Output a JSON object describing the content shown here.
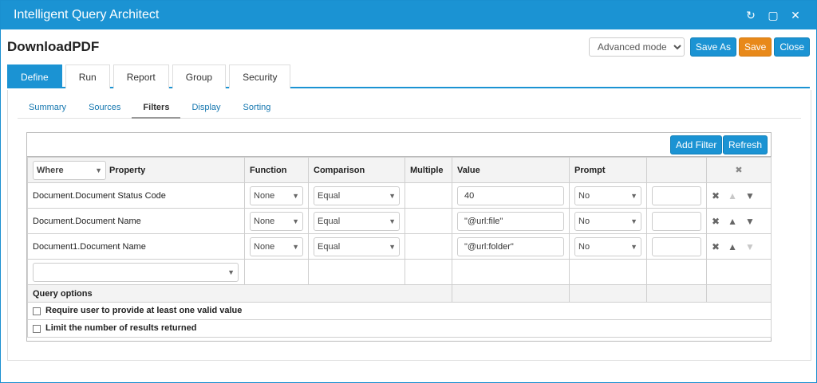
{
  "window": {
    "title": "Intelligent Query Architect",
    "icons": [
      "refresh-icon",
      "maximize-icon",
      "close-icon"
    ]
  },
  "header": {
    "doc_title": "DownloadPDF",
    "mode": "Advanced mode",
    "save_as": "Save As",
    "save": "Save",
    "close": "Close"
  },
  "tabs": [
    {
      "label": "Define",
      "active": true
    },
    {
      "label": "Run"
    },
    {
      "label": "Report"
    },
    {
      "label": "Group"
    },
    {
      "label": "Security"
    }
  ],
  "subtabs": [
    {
      "label": "Summary"
    },
    {
      "label": "Sources"
    },
    {
      "label": "Filters",
      "active": true
    },
    {
      "label": "Display"
    },
    {
      "label": "Sorting"
    }
  ],
  "toolbar": {
    "add_filter": "Add Filter",
    "refresh": "Refresh"
  },
  "columns": {
    "where": "Where",
    "property": "Property",
    "function": "Function",
    "comparison": "Comparison",
    "multiple": "Multiple",
    "value": "Value",
    "prompt": "Prompt"
  },
  "rows": [
    {
      "property": "Document.Document Status Code",
      "function": "None",
      "comparison": "Equal",
      "value": "40",
      "prompt": "No"
    },
    {
      "property": "Document.Document Name",
      "function": "None",
      "comparison": "Equal",
      "value": "\"@url:file\"",
      "prompt": "No"
    },
    {
      "property": "Document1.Document Name",
      "function": "None",
      "comparison": "Equal",
      "value": "\"@url:folder\"",
      "prompt": "No"
    }
  ],
  "query_options": {
    "heading": "Query options",
    "require_valid": "Require user to provide at least one valid value",
    "limit_results": "Limit the number of results returned"
  },
  "colors": {
    "accent": "#1b93d3",
    "save": "#e8891a"
  }
}
